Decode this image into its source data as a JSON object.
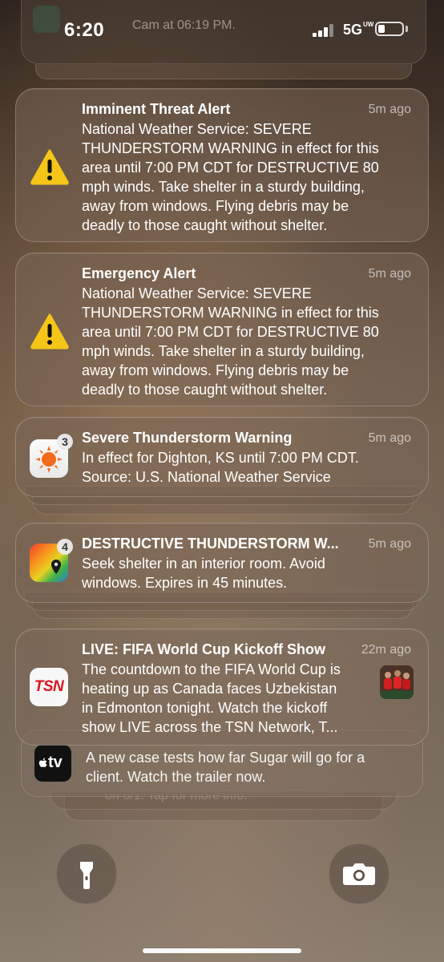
{
  "status_bar": {
    "time": "6:20",
    "network": "5G",
    "network_superscript": "UW",
    "top_stub_text": "Cam at 06:19 PM."
  },
  "notifications": [
    {
      "icon": "warning-icon",
      "title": "Imminent Threat Alert",
      "time": "5m ago",
      "body_lines": [
        "National Weather Service: SEVERE",
        "THUNDERSTORM WARNING in effect for this",
        "area until 7:00 PM CDT for DESTRUCTIVE 80",
        "mph winds. Take shelter in a sturdy building,",
        "away from windows. Flying debris may be",
        "deadly to those caught without shelter."
      ]
    },
    {
      "icon": "warning-icon",
      "title": "Emergency Alert",
      "time": "5m ago",
      "body_lines": [
        "National Weather Service: SEVERE",
        "THUNDERSTORM WARNING in effect for this",
        "area until 7:00 PM CDT for DESTRUCTIVE 80",
        "mph winds. Take shelter in a sturdy building,",
        "away from windows. Flying debris may be",
        "deadly to those caught without shelter."
      ]
    },
    {
      "icon": "weather-sun-app-icon",
      "badge": "3",
      "title": "Severe Thunderstorm Warning",
      "time": "5m ago",
      "body_lines": [
        "In effect for Dighton, KS until 7:00 PM CDT.",
        "Source: U.S. National Weather Service"
      ]
    },
    {
      "icon": "radar-map-app-icon",
      "badge": "4",
      "title": "DESTRUCTIVE THUNDERSTORM W...",
      "time": "5m ago",
      "body_lines": [
        "Seek shelter in an interior room. Avoid",
        "windows. Expires in 45 minutes."
      ]
    },
    {
      "icon": "tsn-app-icon",
      "app_logo_text": "TSN",
      "title": "LIVE: FIFA World Cup Kickoff Show",
      "time": "22m ago",
      "body_lines": [
        "The countdown to the FIFA World Cup is",
        "heating up as Canada faces Uzbekistan",
        "in Edmonton tonight. Watch the kickoff",
        "show LIVE across the TSN Network, T..."
      ]
    }
  ],
  "appletv": {
    "icon_text": "tv",
    "body_lines": [
      "A new case tests how far Sugar will go for a",
      "client. Watch the trailer now."
    ],
    "stub_text": "on 6/1. Tap for more info."
  },
  "controls": {
    "left": "flashlight-icon",
    "right": "camera-icon"
  },
  "colors": {
    "warning_yellow": "#f5c518",
    "tsn_red": "#d8161e",
    "weather_orange": "#f26a1b"
  }
}
